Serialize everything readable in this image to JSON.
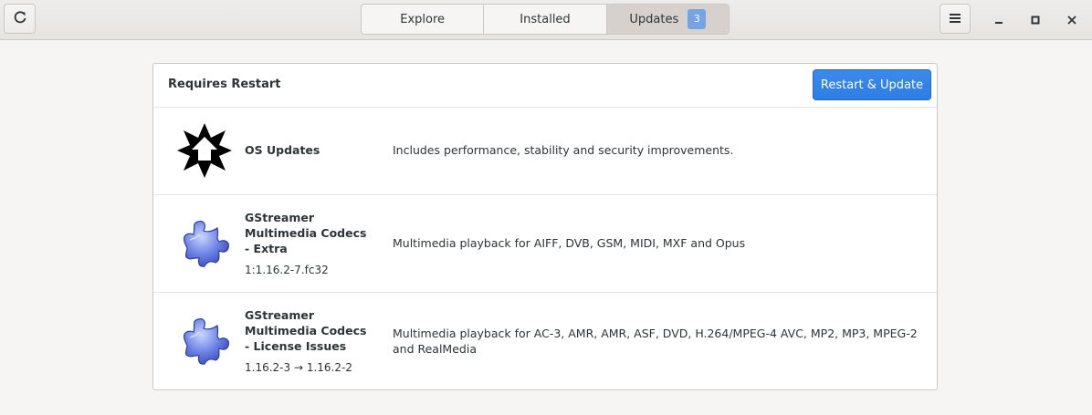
{
  "header": {
    "tabs": [
      {
        "label": "Explore"
      },
      {
        "label": "Installed"
      },
      {
        "label": "Updates",
        "badge": "3"
      }
    ],
    "icons": {
      "refresh": "refresh-icon",
      "menu": "hamburger-menu-icon",
      "minimize": "minimize-icon",
      "maximize": "maximize-icon",
      "close": "close-icon"
    }
  },
  "updates": {
    "section_title": "Requires Restart",
    "restart_label": "Restart & Update",
    "items": [
      {
        "name": "OS Updates",
        "description": "Includes performance, stability and security improvements.",
        "icon": "os-update-icon"
      },
      {
        "name": "GStreamer Multimedia Codecs - Extra",
        "version": "1:1.16.2-7.fc32",
        "description": "Multimedia playback for AIFF, DVB, GSM, MIDI, MXF and Opus",
        "icon": "puzzle-piece-icon"
      },
      {
        "name": "GStreamer Multimedia Codecs - License Issues",
        "version": "1.16.2-3 → 1.16.2-2",
        "description": "Multimedia playback for AC-3, AMR, AMR, ASF, DVD, H.264/MPEG-4 AVC, MP2, MP3, MPEG-2 and RealMedia",
        "icon": "puzzle-piece-icon"
      }
    ]
  },
  "colors": {
    "accent": "#3584e4",
    "badge": "#74a4e2",
    "background": "#f6f5f4"
  }
}
